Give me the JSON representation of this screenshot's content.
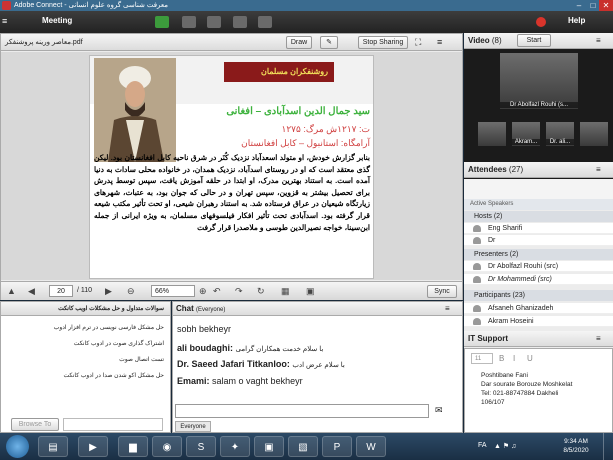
{
  "window": {
    "title": "Adobe Connect - معرفت شناسی گروه علوم انسانی"
  },
  "menu": {
    "meeting": "Meeting",
    "help": "Help"
  },
  "share_pod": {
    "filename": "معاصر ورینه پروشنفکر.pdf",
    "draw_label": "Draw",
    "stop_sharing_label": "Stop Sharing",
    "slide": {
      "banner": "روشنفکران مسلمان",
      "title": "سید جمال الدین اسدآبادی – افغانی",
      "dates": "ت: ۱۲۱۷ش مرگ: ۱۲۷۵",
      "place": "آرامگاه: استانبول – کابل افغانستان",
      "body": "بنابر گزارش خودش، او متولد اسعدآباد نزدیک کُنَر در شرق ناحیه کابل افغانستان بود. لیکن گذی معتقد است که او در روستای اسدآباد، نزدیک همدان، در خانواده محلی سادات به دنیا آمده است. به استناد بهترین مدرک، او ابتدا در حلقه آموزش یافت، سپس توسط پدرش برای تحصیل بیشتر به قزوین، سپس تهران و در حالی که جوان بود، به عتبات، شهرهای زیارتگاه شیعیان در عراق فرستاده شد. به استناد رهبران شیعی، او تحت تأثیر مکتب شیعه قرار گرفته بود. اسدآبادی تحت تأثیر افکار فیلسوفهای مسلمان، به ویژه ایرانی از جمله ابن‌سینا، خواجه نصیرالدین طوسی و ملاصدرا قرار گرفت"
    },
    "page_current": "20",
    "page_total": "/ 110",
    "zoom": "66%",
    "sync_label": "Sync"
  },
  "video": {
    "title": "Video",
    "count": "(8)",
    "start_label": "Start",
    "tiles": [
      {
        "name": "Dr Abolfazl Rouhi (s..."
      },
      {
        "name": ""
      },
      {
        "name": "Akram..."
      },
      {
        "name": "Dr. ali..."
      }
    ]
  },
  "attendees": {
    "title": "Attendees",
    "count": "(27)",
    "active_speakers": "Active Speakers",
    "hosts_label": "Hosts (2)",
    "hosts": [
      "Eng Sharifi",
      "Dr"
    ],
    "presenters_label": "Presenters (2)",
    "presenters": [
      "Dr Abolfazl Rouhi (src)",
      "Dr Mohammedi (src)"
    ],
    "participants_label": "Participants (23)",
    "participants": [
      "Afsaneh Ghanizadeh",
      "Akram Hoseini"
    ]
  },
  "qa": {
    "title": "سوالات متداول و حل مشکلات اویب کانکت",
    "items": [
      "حل مشکل فارسی نویسی در ترم افزار ادوب",
      "اشتراک گذاری صوت در ادوب کانکت",
      "تست اتصال صوت",
      "حل مشکل اکو شدن صدا در ادوب کانکت"
    ],
    "browse_label": "Browse To"
  },
  "chat": {
    "title": "Chat",
    "audience": "(Everyone)",
    "messages": [
      {
        "sender": "",
        "text": "sobh bekheyr"
      },
      {
        "sender": "ali boudaghi:",
        "text": "با سلام خدمت همکاران گرامی"
      },
      {
        "sender": "Dr. Saeed Jafari Titkanloo:",
        "text": "با سلام عرض ادب"
      },
      {
        "sender": "Emami:",
        "text": "salam o vaght bekheyr"
      }
    ],
    "tab_label": "Everyone"
  },
  "it_support": {
    "title": "IT Support",
    "font_size": "11",
    "lines": [
      "Poshtibane Fani",
      "Dar sourate Borouze Moshkelat",
      "Tel: 021-88747884 Dakheli",
      "106/107"
    ]
  },
  "taskbar": {
    "lang": "FA",
    "time": "9:34 AM",
    "date": "8/5/2020"
  }
}
